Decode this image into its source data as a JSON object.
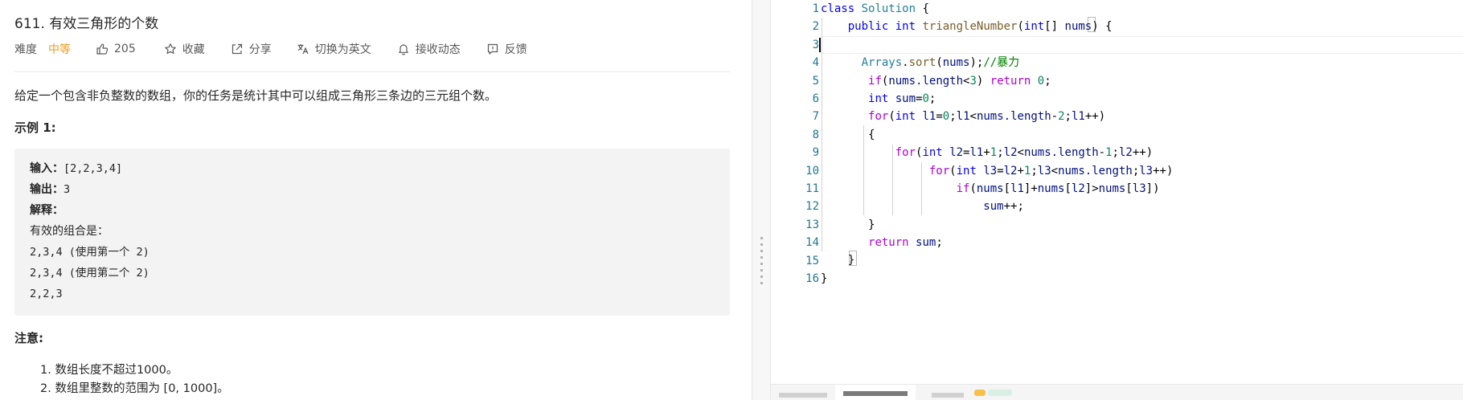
{
  "problem": {
    "title": "611. 有效三角形的个数",
    "difficulty_label": "难度",
    "difficulty_value": "中等",
    "likes": "205",
    "favorite_label": "收藏",
    "share_label": "分享",
    "translate_label": "切换为英文",
    "subscribe_label": "接收动态",
    "feedback_label": "反馈",
    "description": "给定一个包含非负整数的数组，你的任务是统计其中可以组成三角形三条边的三元组个数。",
    "example_heading": "示例 1:",
    "example": {
      "input_label": "输入：",
      "input_value": "[2,2,3,4]",
      "output_label": "输出：",
      "output_value": "3",
      "explain_label": "解释：",
      "lines": [
        "有效的组合是：",
        "2,3,4 (使用第一个 2)",
        "2,3,4 (使用第二个 2)",
        "2,2,3"
      ]
    },
    "note_heading": "注意:",
    "notes": [
      "1. 数组长度不超过1000。",
      "2. 数组里整数的范围为 [0, 1000]。"
    ]
  },
  "editor": {
    "line_numbers": [
      "1",
      "2",
      "3",
      "4",
      "5",
      "6",
      "7",
      "8",
      "9",
      "10",
      "11",
      "12",
      "13",
      "14",
      "15",
      "16"
    ],
    "code": {
      "l1_kw": "class",
      "l1_cls": "Solution",
      "l1_rest": " {",
      "l2_kw1": "public",
      "l2_kw2": "int",
      "l2_fn": "triangleNumber",
      "l2_p1": "(",
      "l2_kw3": "int",
      "l2_p2": "[] ",
      "l2_var": "nums",
      "l2_p3": ") {",
      "l4_cls": "Arrays",
      "l4_p1": ".",
      "l4_fn": "sort",
      "l4_p2": "(",
      "l4_var": "nums",
      "l4_p3": ");",
      "l4_com": "//暴力",
      "l5_ctl": "if",
      "l5_p1": "(",
      "l5_var": "nums.length",
      "l5_p2": "<",
      "l5_num": "3",
      "l5_p3": ") ",
      "l5_ctl2": "return",
      "l5_p4": " ",
      "l5_num2": "0",
      "l5_p5": ";",
      "l6_kw": "int",
      "l6_p1": " ",
      "l6_var": "sum",
      "l6_p2": "=",
      "l6_num": "0",
      "l6_p3": ";",
      "l7_ctl": "for",
      "l7_p1": "(",
      "l7_kw": "int",
      "l7_rest_a": " ",
      "l7_var1": "l1",
      "l7_p2": "=",
      "l7_num1": "0",
      "l7_p3": ";",
      "l7_var2": "l1",
      "l7_p4": "<",
      "l7_var3": "nums.length",
      "l7_p5": "-",
      "l7_num2": "2",
      "l7_p6": ";",
      "l7_var4": "l1",
      "l7_p7": "++)",
      "l8_p": "{",
      "l9_ctl": "for",
      "l9_p1": "(",
      "l9_kw": "int",
      "l9_p2": " ",
      "l9_var1": "l2",
      "l9_p3": "=",
      "l9_var2": "l1",
      "l9_p4": "+",
      "l9_num1": "1",
      "l9_p5": ";",
      "l9_var3": "l2",
      "l9_p6": "<",
      "l9_var4": "nums.length",
      "l9_p7": "-",
      "l9_num2": "1",
      "l9_p8": ";",
      "l9_var5": "l2",
      "l9_p9": "++)",
      "l10_ctl": "for",
      "l10_p1": "(",
      "l10_kw": "int",
      "l10_p2": " ",
      "l10_var1": "l3",
      "l10_p3": "=",
      "l10_var2": "l2",
      "l10_p4": "+",
      "l10_num": "1",
      "l10_p5": ";",
      "l10_var3": "l3",
      "l10_p6": "<",
      "l10_var4": "nums.length",
      "l10_p7": ";",
      "l10_var5": "l3",
      "l10_p8": "++)",
      "l11_ctl": "if",
      "l11_p1": "(",
      "l11_var1": "nums",
      "l11_p2": "[",
      "l11_var2": "l1",
      "l11_p3": "]+",
      "l11_var3": "nums",
      "l11_p4": "[",
      "l11_var4": "l2",
      "l11_p5": "]>",
      "l11_var5": "nums",
      "l11_p6": "[",
      "l11_var6": "l3",
      "l11_p7": "])",
      "l12_var": "sum",
      "l12_p": "++;",
      "l13_p": "}",
      "l14_ctl": "return",
      "l14_p1": " ",
      "l14_var": "sum",
      "l14_p2": ";",
      "l15_p": "}",
      "l16_p": "}"
    }
  },
  "icons": {
    "like": "thumbs-up-icon",
    "favorite": "star-icon",
    "share": "share-icon",
    "translate": "translate-icon",
    "subscribe": "bell-icon",
    "feedback": "feedback-icon"
  },
  "colors": {
    "difficulty": "#ef9a22",
    "keyword": "#0000ff",
    "control": "#af00db",
    "type": "#267f99",
    "function": "#795e26",
    "variable": "#001080",
    "number": "#098658",
    "comment": "#008000",
    "line_number": "#237893"
  }
}
